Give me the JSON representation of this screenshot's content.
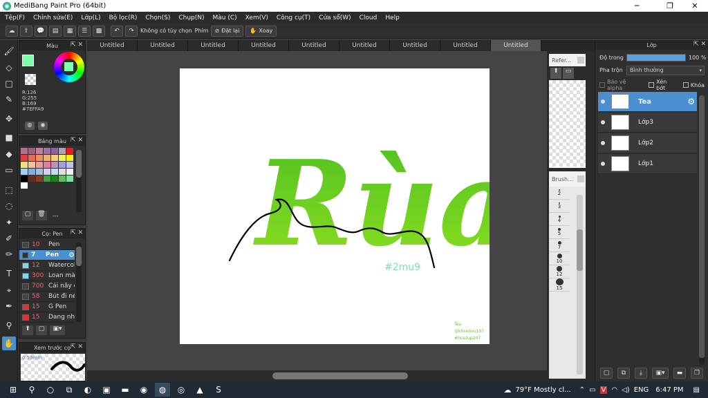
{
  "window": {
    "title": "MediBang Paint Pro (64bit)"
  },
  "menu": [
    "Tệp(F)",
    "Chỉnh sửa(E)",
    "Lớp(L)",
    "Bộ lọc(R)",
    "Chọn(S)",
    "Chụp(N)",
    "Màu (C)",
    "Xem(V)",
    "Công cụ(T)",
    "Cửa sổ(W)",
    "Cloud",
    "Help"
  ],
  "toolbar": {
    "no_option": "Không có tùy chọn",
    "keys_label": "Phím",
    "reset_label": "Đặt lại",
    "rotate_label": "Xoay"
  },
  "color_panel": {
    "title": "Màu",
    "r": "R:126",
    "g": "G:255",
    "b": "B:169",
    "hex": "#7EFFA9",
    "primary": "#7EFFA9"
  },
  "palette_panel": {
    "title": "Bảng màu",
    "footer": "---",
    "swatches": [
      "#b07090",
      "#a06080",
      "#c080a0",
      "#a070a0",
      "#9060a0",
      "#b0a0b0",
      "#e02020",
      "#e04040",
      "#e07050",
      "#f09060",
      "#f0b070",
      "#f0d080",
      "#f0f060",
      "#f0f020",
      "#f0e080",
      "#f0c0a0",
      "#e0a0a0",
      "#e080a0",
      "#c090c0",
      "#a0a0e0",
      "#c0c0f0",
      "#a0d0f0",
      "#80b0e0",
      "#a0c0e0",
      "#d0d0f0",
      "#c0e0f0",
      "#e0e0e0",
      "#f0f0f0",
      "#000000",
      "#603020",
      "#804020",
      "#40a040",
      "#208020",
      "#60c060",
      "#80e0a0",
      "#ffffff"
    ]
  },
  "brush_panel": {
    "title": "Cọ: Pen",
    "brushes": [
      {
        "size": "10",
        "name": "Pen",
        "color": "#444444"
      },
      {
        "size": "7",
        "name": "Pen",
        "color": "#333333"
      },
      {
        "size": "12",
        "name": "Watercolor",
        "color": "#7ed8f0"
      },
      {
        "size": "300",
        "name": "Loan màu",
        "color": "#7ed8f0"
      },
      {
        "size": "700",
        "name": "Cái nầy đi",
        "color": "#444444"
      },
      {
        "size": "58",
        "name": "Bút đi nét",
        "color": "#444444"
      },
      {
        "size": "15",
        "name": "G Pen",
        "color": "#e03030"
      },
      {
        "size": "15",
        "name": "Dang nhưng",
        "color": "#e03030"
      }
    ]
  },
  "preview_panel": {
    "title": "Xem trước cọ",
    "size": "0.59mm"
  },
  "tabs": [
    "Untitled",
    "Untitled",
    "Untitled",
    "Untitled",
    "Untitled",
    "Untitled",
    "Untitled",
    "Untitled",
    "Untitled"
  ],
  "canvas": {
    "word": "Rùa",
    "script": "rùa",
    "tag": "#2mu9",
    "sig1": "Tea",
    "sig2": "@khvenvu197",
    "sig3": "#hcsdup247"
  },
  "reference_panel": {
    "title": "Refer..."
  },
  "brushsize_panel": {
    "title": "Brush...",
    "sizes": [
      "2",
      "3",
      "4",
      "5",
      "7",
      "10",
      "12",
      "15"
    ]
  },
  "layer_panel": {
    "title": "Lớp",
    "opacity_label": "Độ trong",
    "opacity_value": "100 %",
    "opacity_fraction": 1.0,
    "blend_label": "Pha trộn",
    "blend_value": "Bình thường",
    "protect_alpha": "Bảo vệ alpha",
    "clip": "Xén bớt",
    "lock": "Khóa",
    "layers": [
      {
        "name": "Tea",
        "selected": true
      },
      {
        "name": "Lớp3"
      },
      {
        "name": "Lớp2"
      },
      {
        "name": "Lớp1"
      }
    ]
  },
  "taskbar": {
    "weather": "79°F  Mostly cl...",
    "lang": "ENG",
    "time": "6:47 PM"
  }
}
